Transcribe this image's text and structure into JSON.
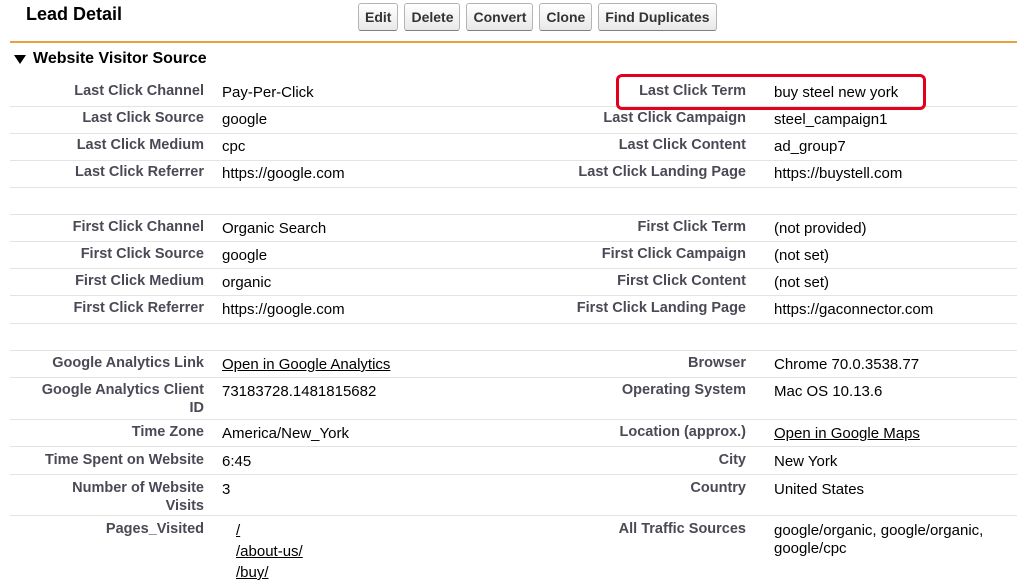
{
  "header": {
    "title": "Lead Detail",
    "buttons": {
      "edit": "Edit",
      "delete": "Delete",
      "convert": "Convert",
      "clone": "Clone",
      "find_duplicates": "Find Duplicates"
    }
  },
  "section": {
    "title": "Website Visitor Source"
  },
  "colors": {
    "accent_line": "#e8a239",
    "highlight": "#e3001b",
    "label": "#4a4a56"
  },
  "last_click": {
    "channel_label": "Last Click Channel",
    "channel": "Pay-Per-Click",
    "term_label": "Last Click Term",
    "term": "buy steel new york",
    "source_label": "Last Click Source",
    "source": "google",
    "campaign_label": "Last Click Campaign",
    "campaign": "steel_campaign1",
    "medium_label": "Last Click Medium",
    "medium": "cpc",
    "content_label": "Last Click Content",
    "content": "ad_group7",
    "referrer_label": "Last Click Referrer",
    "referrer": "https://google.com",
    "landing_label": "Last Click Landing Page",
    "landing": "https://buystell.com"
  },
  "first_click": {
    "channel_label": "First Click Channel",
    "channel": "Organic Search",
    "term_label": "First Click Term",
    "term": "(not provided)",
    "source_label": "First Click Source",
    "source": "google",
    "campaign_label": "First Click Campaign",
    "campaign": "(not set)",
    "medium_label": "First Click Medium",
    "medium": "organic",
    "content_label": "First Click Content",
    "content": "(not set)",
    "referrer_label": "First Click Referrer",
    "referrer": "https://google.com",
    "landing_label": "First Click Landing Page",
    "landing": "https://gaconnector.com"
  },
  "details": {
    "ga_link_label": "Google Analytics Link",
    "ga_link": "Open in Google Analytics",
    "browser_label": "Browser",
    "browser": "Chrome 70.0.3538.77",
    "ga_client_label_1": "Google Analytics Client",
    "ga_client_label_2": "ID",
    "ga_client": "73183728.1481815682",
    "os_label": "Operating System",
    "os": "Mac OS 10.13.6",
    "timezone_label": "Time Zone",
    "timezone": "America/New_York",
    "location_label": "Location (approx.)",
    "location": "Open in Google Maps",
    "time_spent_label": "Time Spent on Website",
    "time_spent": "6:45",
    "city_label": "City",
    "city": "New York",
    "visits_label_1": "Number of Website",
    "visits_label_2": "Visits",
    "visits": "3",
    "country_label": "Country",
    "country": "United States",
    "pages_label": "Pages_Visited",
    "pages": [
      "/",
      "/about-us/",
      "/buy/"
    ],
    "traffic_label": "All Traffic Sources",
    "traffic_1": "google/organic, google/organic,",
    "traffic_2": "google/cpc"
  }
}
